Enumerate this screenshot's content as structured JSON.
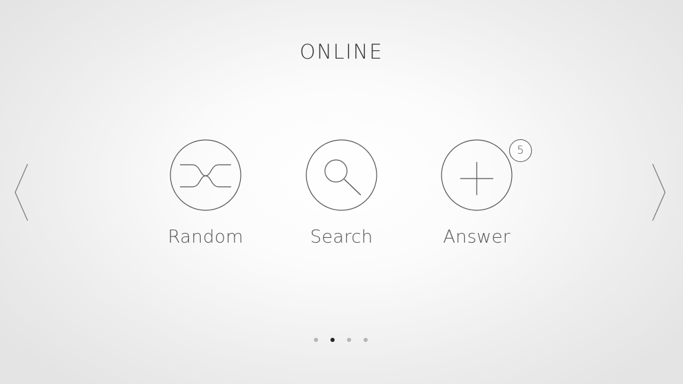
{
  "header": {
    "title": "ONLINE"
  },
  "navigation": {
    "prev_icon": "chevron-left-icon",
    "next_icon": "chevron-right-icon"
  },
  "tiles": [
    {
      "label": "Random",
      "icon": "shuffle-icon"
    },
    {
      "label": "Search",
      "icon": "magnifier-icon"
    },
    {
      "label": "Answer",
      "icon": "plus-icon",
      "badge": "5"
    }
  ],
  "pager": {
    "total_pages": 4,
    "active_page": 2
  },
  "colors": {
    "text": "#333333",
    "stroke": "#555555",
    "dot_inactive": "#b5b5b5",
    "dot_active": "#222222"
  }
}
